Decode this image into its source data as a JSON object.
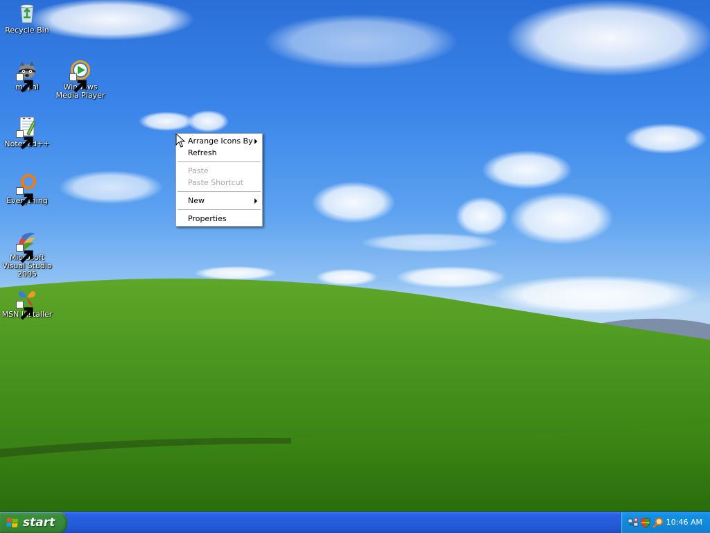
{
  "desktop": {
    "icons": [
      {
        "label": "Recycle Bin",
        "icon": "recycle-bin-icon",
        "shortcut": false
      },
      {
        "label": "mypal",
        "icon": "mypal-icon",
        "shortcut": true
      },
      {
        "label": "Windows Media Player",
        "icon": "windows-media-player-icon",
        "shortcut": true
      },
      {
        "label": "Notepad++",
        "icon": "notepadplusplus-icon",
        "shortcut": true
      },
      {
        "label": "Everything",
        "icon": "everything-search-icon",
        "shortcut": true
      },
      {
        "label": "Microsoft Visual Studio 2005",
        "icon": "visual-studio-icon",
        "shortcut": true
      },
      {
        "label": "MSN Installer",
        "icon": "msn-butterfly-icon",
        "shortcut": true
      }
    ]
  },
  "context_menu": {
    "items": [
      {
        "label": "Arrange Icons By",
        "enabled": true,
        "submenu": true
      },
      {
        "label": "Refresh",
        "enabled": true,
        "submenu": false
      },
      {
        "separator": true
      },
      {
        "label": "Paste",
        "enabled": false,
        "submenu": false
      },
      {
        "label": "Paste Shortcut",
        "enabled": false,
        "submenu": false
      },
      {
        "separator": true
      },
      {
        "label": "New",
        "enabled": true,
        "submenu": true
      },
      {
        "separator": true
      },
      {
        "label": "Properties",
        "enabled": true,
        "submenu": false
      }
    ]
  },
  "taskbar": {
    "start_label": "start",
    "tray_icons": [
      "network-icon",
      "security-shield-icon",
      "search-magnifier-icon"
    ],
    "clock": "10:46 AM"
  },
  "colors": {
    "taskbar_blue": "#245ddb",
    "start_green": "#368a36",
    "tray_blue": "#1388d9",
    "menu_disabled_text": "#a7a6aa"
  }
}
